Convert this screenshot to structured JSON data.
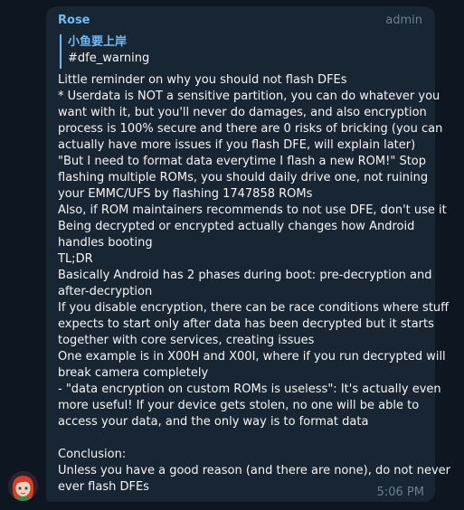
{
  "message": {
    "sender": "Rose",
    "role": "admin",
    "reply": {
      "title": "小鱼要上岸",
      "text": "#dfe_warning"
    },
    "lines": [
      "Little reminder on why you should not flash DFEs",
      "* Userdata is NOT a sensitive partition, you can do whatever you",
      "want with it, but you'll never do damages, and also encryption",
      "process is 100% secure and there are 0 risks of bricking (you can",
      "actually have more issues if you flash DFE, will explain later)",
      "\"But I need to format data everytime I flash a new ROM!\" Stop",
      "flashing multiple ROMs, you should daily drive one, not ruining",
      "your EMMC/UFS by flashing 1747858 ROMs",
      "Also, if ROM maintainers recommends to not use DFE, don't use it",
      "Being decrypted or encrypted actually changes how Android",
      "handles booting",
      "TL;DR",
      "Basically Android has 2 phases during boot: pre-decryption and",
      "after-decryption",
      "If you disable encryption, there can be race conditions where stuff",
      "expects to start only after data has been decrypted but it starts",
      "together with core services, creating issues",
      "One example is in X00H and X00I, where if you run decrypted will",
      "break camera completely",
      "- \"data encryption on custom ROMs is useless\": It's actually even",
      "more useful! If your device gets stolen, no one will be able to",
      "access your data, and the only way is to format data",
      "",
      "Conclusion:",
      "Unless you have a good reason (and there are none), do not never",
      "ever flash DFEs"
    ],
    "time": "5:06 PM"
  },
  "colors": {
    "background": "#0e1621",
    "bubble": "#182533",
    "accent": "#71baf2",
    "text": "#f5f5f5",
    "muted": "#6d7f8f"
  }
}
